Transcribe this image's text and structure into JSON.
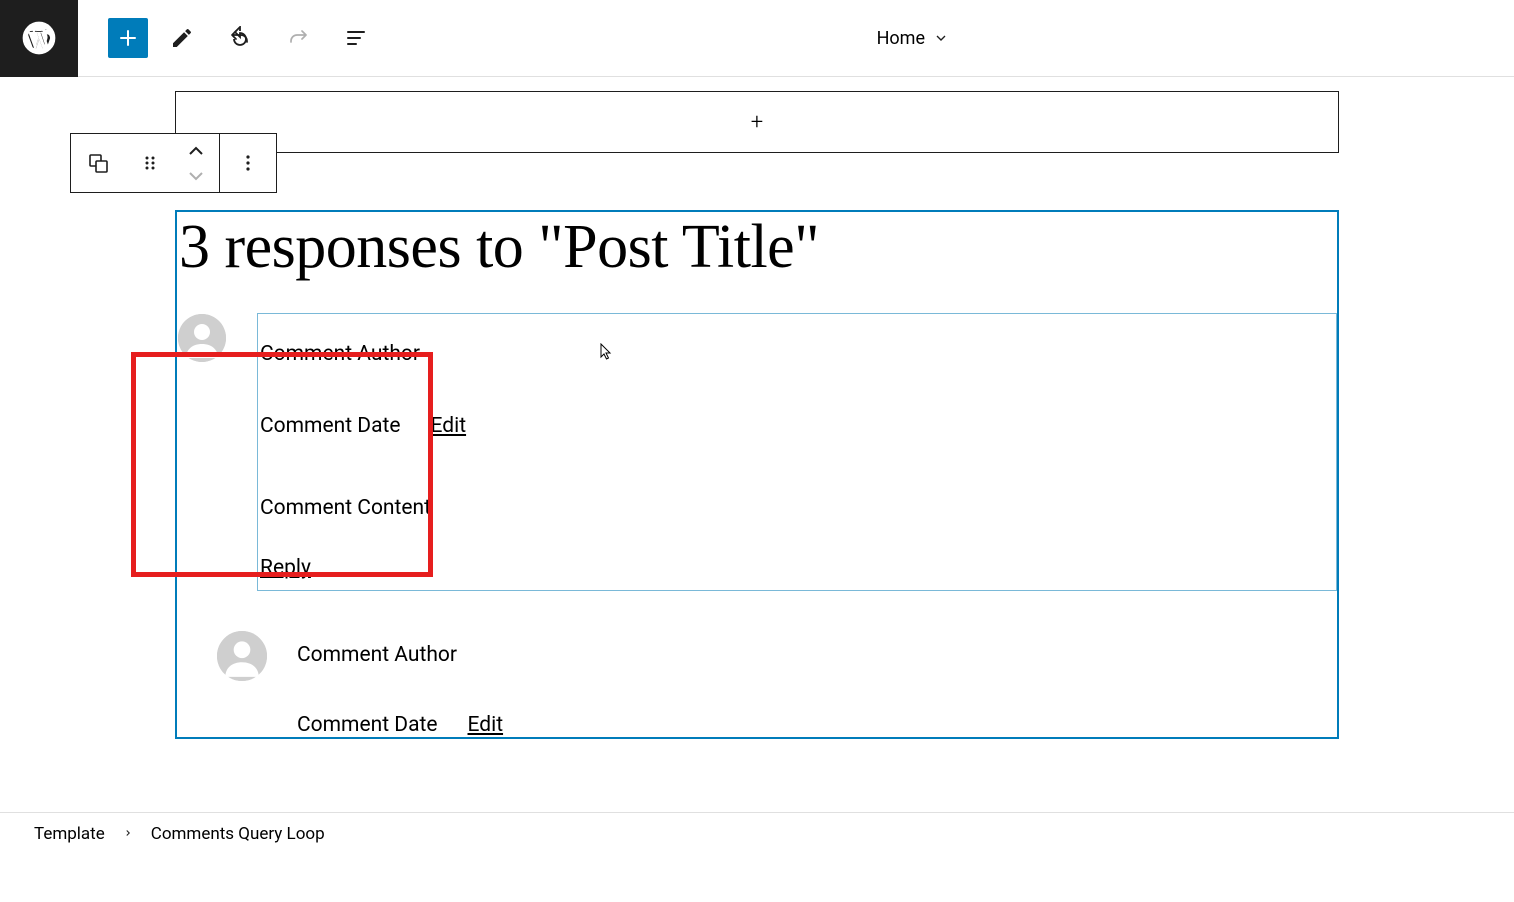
{
  "toolbar": {
    "home_label": "Home"
  },
  "comments_block": {
    "title": "3 responses to \"Post Title\""
  },
  "comments": [
    {
      "author": "Comment Author",
      "date": "Comment Date",
      "edit": "Edit",
      "content": "Comment Content",
      "reply": "Reply"
    },
    {
      "author": "Comment Author",
      "date": "Comment Date",
      "edit": "Edit"
    }
  ],
  "breadcrumb": {
    "template": "Template",
    "current": "Comments Query Loop"
  }
}
